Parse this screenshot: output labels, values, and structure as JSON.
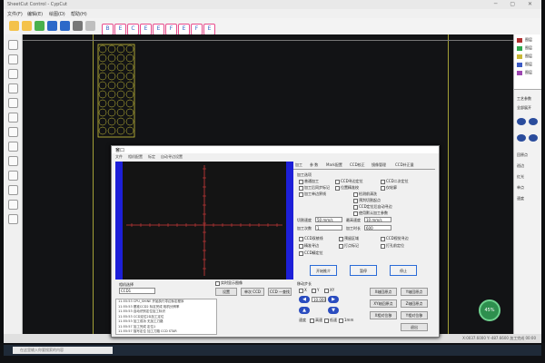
{
  "app": {
    "title": "SheetCut Control - CypCut",
    "menu": [
      "文件(F)",
      "编辑(E)",
      "绘图(D)",
      "帮助(H)"
    ],
    "window_controls": "─ ▢ ✕"
  },
  "toolbar": {
    "buttons": [
      {
        "icon": "open-icon",
        "color": "#f4c24a"
      },
      {
        "icon": "save-icon",
        "color": "#f4c24a"
      },
      {
        "icon": "play-icon",
        "color": "#49b04d"
      },
      {
        "icon": "start-icon",
        "color": "#2c69c9"
      },
      {
        "icon": "stop-icon",
        "color": "#2c69c9"
      },
      {
        "icon": "settings-icon",
        "color": "#777777"
      },
      {
        "icon": "tool-icon",
        "color": "#bfbfbf"
      }
    ],
    "letter_buttons": [
      "B",
      "E",
      "C",
      "E",
      "E",
      "F",
      "E",
      "F",
      "E"
    ],
    "colors": {
      "ribbon_pink": "#e84b8c",
      "ribbon_blue": "#345fc4"
    }
  },
  "canvas": {
    "part_color": "#cfc63a",
    "nest_color": "#7fb13e"
  },
  "right_panel": {
    "layers": [
      {
        "color": "#b03030",
        "label": "图层"
      },
      {
        "color": "#2fa84c",
        "label": "图层"
      },
      {
        "color": "#c9b836",
        "label": "图层"
      },
      {
        "color": "#3c5bc4",
        "label": "图层"
      },
      {
        "color": "#9c46b0",
        "label": "图层"
      }
    ],
    "items": [
      "工艺参数",
      "全部展开",
      "回原点",
      "巡边",
      "红光",
      "单点",
      "速度"
    ]
  },
  "status_bar": {
    "text": "X:0037.6000 Y:-487.6600  加工完成 00:00"
  },
  "taskbar": {
    "search_placeholder": "在这里输入你要搜索的内容"
  },
  "dialog": {
    "title": "窗口",
    "menu": [
      "文件",
      "相机配置",
      "标定",
      "自动寻边设置"
    ],
    "camera_options": {
      "label": "相机选择",
      "value": "CCD1"
    },
    "camera_checkbox": "实时显示图像",
    "camera_buttons": [
      "设置",
      "单次 CCD",
      "CCD 一查找"
    ],
    "log": [
      "11:55:53  CPU_SHINE  开始执行寻边标定程序",
      "11:55:53  基准CCD2  标定完成  相机分辨率",
      "11:55:53  自动识别定位加工标识",
      "11:55:53  CCD定位2D加工定位",
      "11:55:53  加工成功  无加工刀路",
      "11:55:57  加工完成  定位1",
      "11:55:57  描写定位  加工刀路 CCD STAR"
    ],
    "tabs": [
      "加工",
      "参 数",
      "Mark配置",
      "CCD校正",
      "镜像管理",
      "CCD补正量"
    ],
    "process": {
      "label": "加工选项",
      "options": [
        "普通加工",
        "CCD寻边定位",
        "CCD二次定位",
        "加工后同步标记",
        "位置精准校",
        "仅轮廓",
        "加工单边界线",
        "检测前清洗"
      ],
      "extra": [
        "预判切割起点",
        "CCD定位后自动寻边",
        "使用默认加工参数"
      ]
    },
    "fields": [
      {
        "label": "切割速度",
        "value": "50 mm/s"
      },
      {
        "label": "最高速度",
        "value": "10 mm/s"
      },
      {
        "label": "加工次数",
        "value": "1"
      },
      {
        "label": "加工时长",
        "value": "600"
      }
    ],
    "seg_options": [
      "CCD双棱线",
      "预留区域",
      "CCD视觉寻边",
      "精准寻边",
      "打点标记",
      "打孔前定位",
      "CCD精定位"
    ],
    "main_buttons": {
      "start": "开始推介",
      "pause": "暂停",
      "stop": "停止"
    },
    "motion": {
      "label": "移动步长",
      "options": [
        "X",
        "Y",
        "XY"
      ],
      "step_value": "10.000",
      "buttons": [
        "X轴回原点",
        "Y轴回原点",
        "XY轴回原点",
        "Z轴回原点",
        "X相对位移",
        "Y相对位移"
      ],
      "speed_label": "速度",
      "speed": [
        "高速",
        "低速",
        "1mm"
      ],
      "close": "退出"
    }
  },
  "overlay": {
    "fps": "45%"
  }
}
